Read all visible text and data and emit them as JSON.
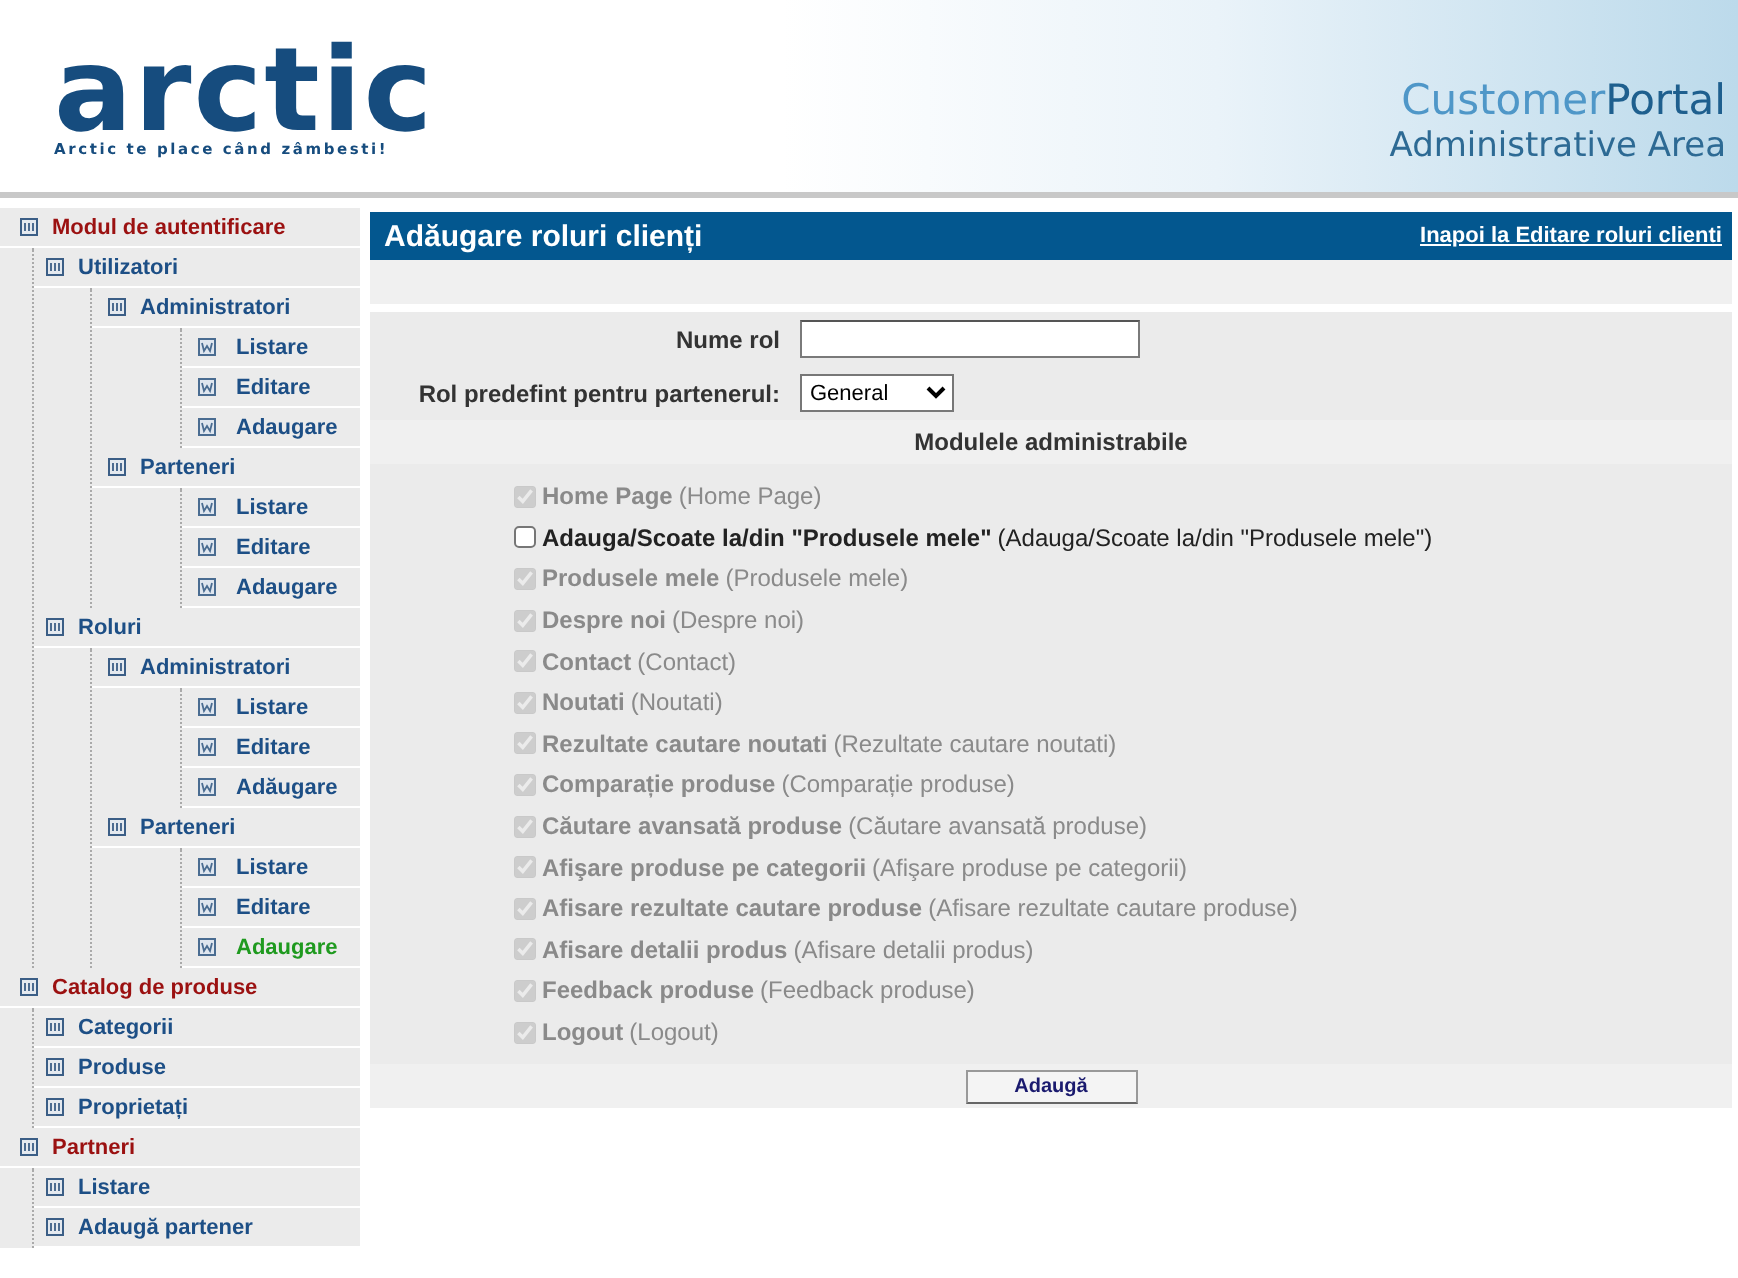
{
  "header": {
    "logo": "arctic",
    "tagline": "Arctic te place când zâmbesti!",
    "portal_light": "Customer",
    "portal_dark": "Portal",
    "area": "Administrative Area"
  },
  "sidebar": {
    "items": [
      {
        "label": "Modul de autentificare",
        "selected": false,
        "children": [
          {
            "label": "Utilizatori",
            "selected": false,
            "children": [
              {
                "label": "Administratori",
                "selected": false,
                "children": [
                  {
                    "label": "Listare",
                    "selected": false
                  },
                  {
                    "label": "Editare",
                    "selected": false
                  },
                  {
                    "label": "Adaugare",
                    "selected": false
                  }
                ]
              },
              {
                "label": "Parteneri",
                "selected": false,
                "children": [
                  {
                    "label": "Listare",
                    "selected": false
                  },
                  {
                    "label": "Editare",
                    "selected": false
                  },
                  {
                    "label": "Adaugare",
                    "selected": false
                  }
                ]
              }
            ]
          },
          {
            "label": "Roluri",
            "selected": false,
            "children": [
              {
                "label": "Administratori",
                "selected": false,
                "children": [
                  {
                    "label": "Listare",
                    "selected": false
                  },
                  {
                    "label": "Editare",
                    "selected": false
                  },
                  {
                    "label": "Adăugare",
                    "selected": false
                  }
                ]
              },
              {
                "label": "Parteneri",
                "selected": false,
                "children": [
                  {
                    "label": "Listare",
                    "selected": false
                  },
                  {
                    "label": "Editare",
                    "selected": false
                  },
                  {
                    "label": "Adaugare",
                    "selected": true
                  }
                ]
              }
            ]
          }
        ]
      },
      {
        "label": "Catalog de produse",
        "selected": false,
        "children": [
          {
            "label": "Categorii",
            "selected": false
          },
          {
            "label": "Produse",
            "selected": false
          },
          {
            "label": "Proprietați",
            "selected": false
          }
        ]
      },
      {
        "label": "Partneri",
        "selected": false,
        "children": [
          {
            "label": "Listare",
            "selected": false
          },
          {
            "label": "Adaugă partener",
            "selected": false
          }
        ]
      }
    ]
  },
  "page": {
    "title": "Adăugare roluri clienți",
    "back_link": "Inapoi la Editare roluri clienti"
  },
  "form": {
    "name_label": "Nume rol",
    "role_label": "Rol predefint pentru partenerul:",
    "role_value": "General",
    "modules_title": "Modulele administrabile",
    "submit": "Adaugă"
  },
  "modules": [
    {
      "label": "Home Page",
      "hint": "(Home Page)",
      "checked": true,
      "disabled": true
    },
    {
      "label": "Adauga/Scoate la/din \"Produsele mele\"",
      "hint": "(Adauga/Scoate la/din \"Produsele mele\")",
      "checked": false,
      "disabled": false
    },
    {
      "label": "Produsele mele",
      "hint": "(Produsele mele)",
      "checked": true,
      "disabled": true
    },
    {
      "label": "Despre noi",
      "hint": "(Despre noi)",
      "checked": true,
      "disabled": true
    },
    {
      "label": "Contact",
      "hint": "(Contact)",
      "checked": true,
      "disabled": true
    },
    {
      "label": "Noutati",
      "hint": "(Noutati)",
      "checked": true,
      "disabled": true
    },
    {
      "label": "Rezultate cautare noutati",
      "hint": "(Rezultate cautare noutati)",
      "checked": true,
      "disabled": true
    },
    {
      "label": "Comparație produse",
      "hint": "(Comparație produse)",
      "checked": true,
      "disabled": true
    },
    {
      "label": "Căutare avansată produse",
      "hint": "(Căutare avansată produse)",
      "checked": true,
      "disabled": true
    },
    {
      "label": "Afişare produse pe categorii",
      "hint": "(Afişare produse pe categorii)",
      "checked": true,
      "disabled": true
    },
    {
      "label": "Afisare rezultate cautare produse",
      "hint": "(Afisare rezultate cautare produse)",
      "checked": true,
      "disabled": true
    },
    {
      "label": "Afisare detalii produs",
      "hint": "(Afisare detalii produs)",
      "checked": true,
      "disabled": true
    },
    {
      "label": "Feedback produse",
      "hint": "(Feedback produse)",
      "checked": true,
      "disabled": true
    },
    {
      "label": "Logout",
      "hint": "(Logout)",
      "checked": true,
      "disabled": true
    }
  ]
}
